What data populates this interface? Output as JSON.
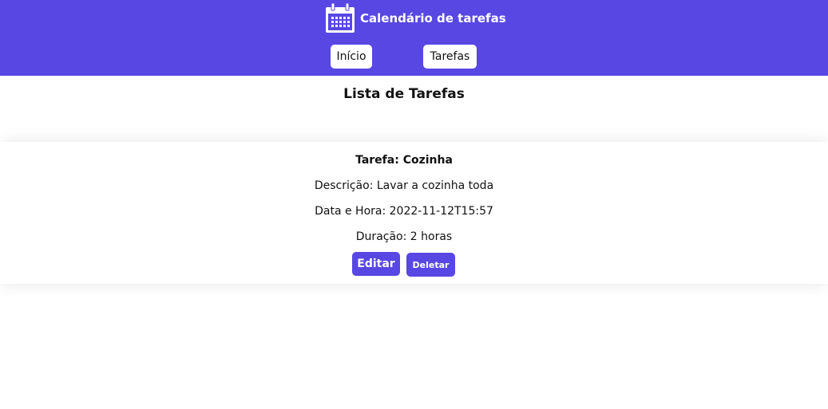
{
  "header": {
    "icon": "calendar-icon",
    "title": "Calendário de tarefas",
    "nav": [
      {
        "label": "Início"
      },
      {
        "label": "Tarefas"
      }
    ],
    "background_color": "#5847e3"
  },
  "main": {
    "title": "Lista de Tarefas",
    "tasks": [
      {
        "title_label": "Tarefa:",
        "title": "Cozinha",
        "description_label": "Descrição:",
        "description": "Lavar a cozinha toda",
        "datetime_label": "Data e Hora:",
        "datetime": "2022-11-12T15:57",
        "duration_label": "Duração:",
        "duration": "2 horas",
        "edit_label": "Editar",
        "delete_label": "Deletar"
      }
    ]
  }
}
